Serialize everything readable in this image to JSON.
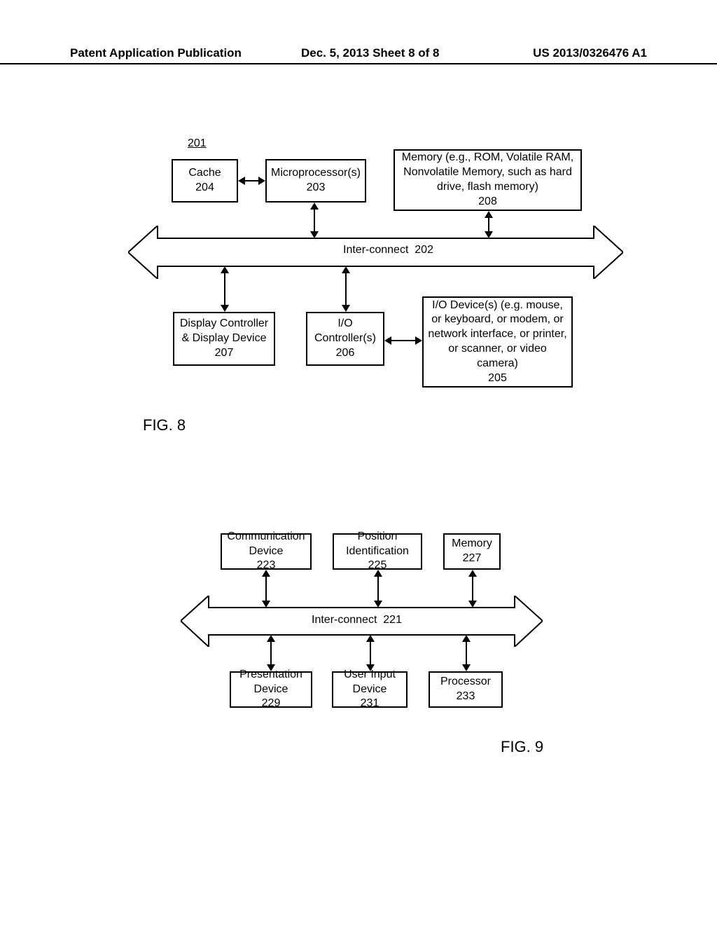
{
  "header": {
    "left": "Patent Application Publication",
    "center": "Dec. 5, 2013   Sheet 8 of 8",
    "right": "US 2013/0326476 A1"
  },
  "fig8": {
    "ref": "201",
    "cache": {
      "label": "Cache",
      "num": "204"
    },
    "micro": {
      "label": "Microprocessor(s)",
      "num": "203"
    },
    "memory": {
      "label": "Memory (e.g., ROM, Volatile RAM, Nonvolatile Memory, such as hard drive, flash memory)",
      "num": "208"
    },
    "bus": {
      "label": "Inter-connect",
      "num": "202"
    },
    "display": {
      "label": "Display Controller & Display Device",
      "num": "207"
    },
    "ioctl": {
      "label": "I/O Controller(s)",
      "num": "206"
    },
    "iodev": {
      "label": "I/O Device(s) (e.g. mouse, or keyboard, or modem, or network interface, or printer, or scanner, or video camera)",
      "num": "205"
    },
    "caption": "FIG. 8"
  },
  "fig9": {
    "comm": {
      "label": "Communication Device",
      "num": "223"
    },
    "pos": {
      "label": "Position Identification",
      "num": "225"
    },
    "mem": {
      "label": "Memory",
      "num": "227"
    },
    "bus": {
      "label": "Inter-connect",
      "num": "221"
    },
    "pres": {
      "label": "Presentation Device",
      "num": "229"
    },
    "uinput": {
      "label": "User Input Device",
      "num": "231"
    },
    "proc": {
      "label": "Processor",
      "num": "233"
    },
    "caption": "FIG. 9"
  }
}
